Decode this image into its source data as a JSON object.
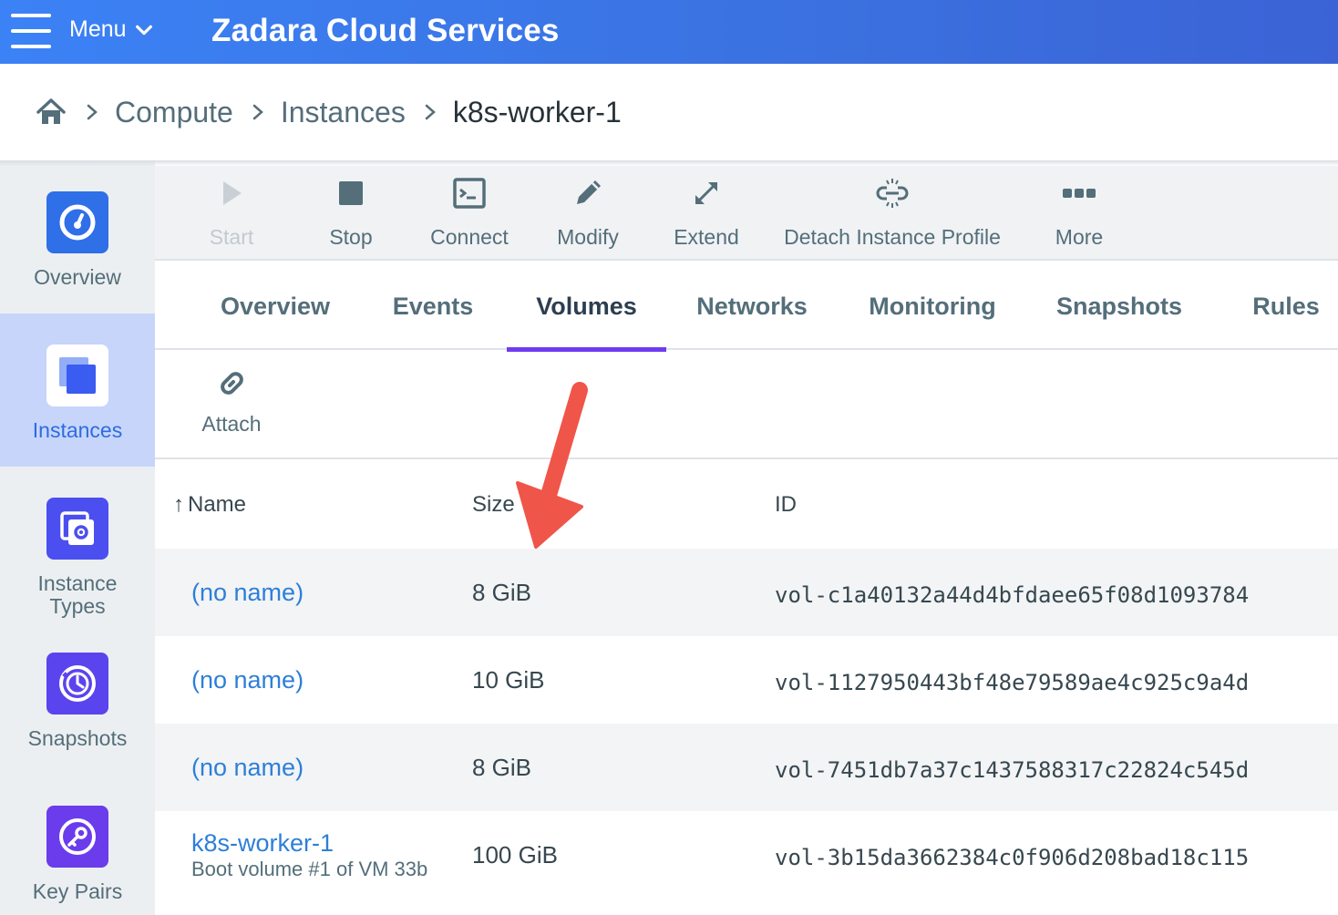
{
  "header": {
    "menu_label": "Menu",
    "app_title": "Zadara Cloud Services"
  },
  "breadcrumb": {
    "home_icon": "home-icon",
    "items": [
      "Compute",
      "Instances",
      "k8s-worker-1"
    ]
  },
  "sidebar": {
    "items": [
      {
        "label": "Overview",
        "icon": "dashboard-icon",
        "active": false
      },
      {
        "label": "Instances",
        "icon": "instances-icon",
        "active": true
      },
      {
        "label": "Instance Types",
        "icon": "instance-types-icon",
        "active": false
      },
      {
        "label": "Snapshots",
        "icon": "snapshots-icon",
        "active": false
      },
      {
        "label": "Key Pairs",
        "icon": "key-icon",
        "active": false
      }
    ]
  },
  "toolbar": {
    "start": "Start",
    "stop": "Stop",
    "connect": "Connect",
    "modify": "Modify",
    "extend": "Extend",
    "detach": "Detach Instance Profile",
    "more": "More"
  },
  "tabs": [
    "Overview",
    "Events",
    "Volumes",
    "Networks",
    "Monitoring",
    "Snapshots",
    "Rules"
  ],
  "active_tab": "Volumes",
  "actions": {
    "attach": "Attach"
  },
  "volumes_table": {
    "columns": {
      "name": "Name",
      "size": "Size",
      "id": "ID"
    },
    "sort_indicator": "↑",
    "rows": [
      {
        "name": "(no name)",
        "sub": "",
        "size": "8 GiB",
        "id": "vol-c1a40132a44d4bfdaee65f08d1093784"
      },
      {
        "name": "(no name)",
        "sub": "",
        "size": "10 GiB",
        "id": "vol-1127950443bf48e79589ae4c925c9a4d"
      },
      {
        "name": "(no name)",
        "sub": "",
        "size": "8 GiB",
        "id": "vol-7451db7a37c1437588317c22824c545d"
      },
      {
        "name": "k8s-worker-1",
        "sub": "Boot volume #1 of VM 33b",
        "size": "100 GiB",
        "id": "vol-3b15da3662384c0f906d208bad18c115"
      }
    ]
  },
  "colors": {
    "header_gradient_start": "#3b82f6",
    "accent_purple": "#6d3cf0",
    "link_blue": "#2d7fd8",
    "annotation_arrow": "#f0554a"
  }
}
